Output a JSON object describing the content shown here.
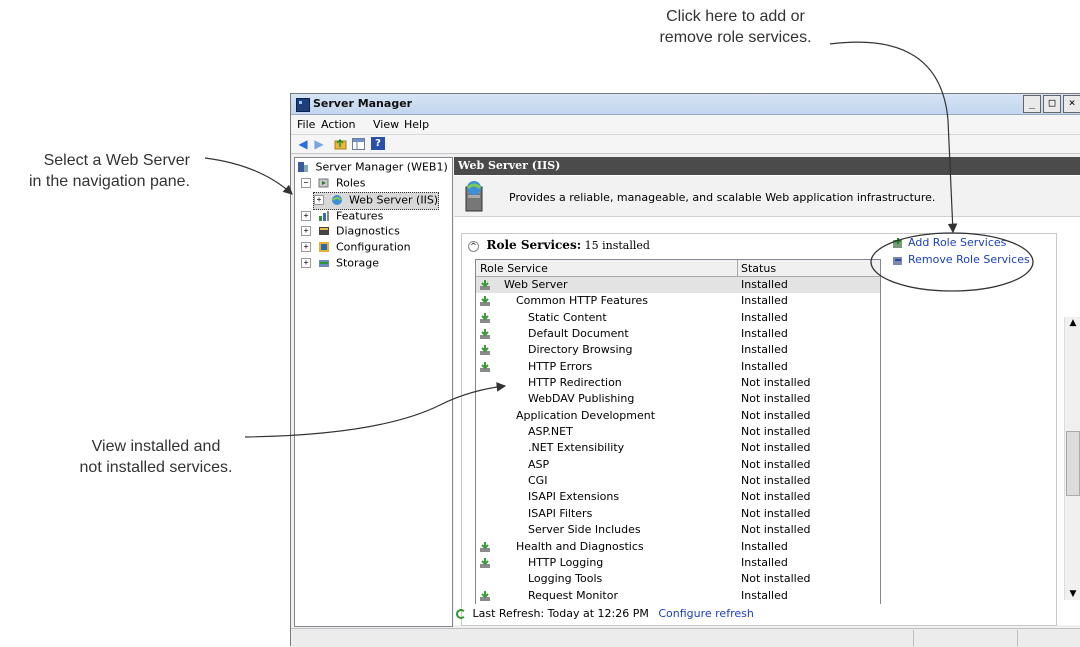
{
  "callouts": {
    "top_right": [
      "Click here to add or",
      "remove role services."
    ],
    "left_top": [
      "Select a Web Server",
      "in the navigation pane."
    ],
    "left_mid": [
      "View installed and",
      "not installed services."
    ]
  },
  "window": {
    "title": "Server Manager",
    "controls": {
      "minimize": "_",
      "maximize": "□",
      "close": "×"
    }
  },
  "menu": [
    "File",
    "Action",
    "View",
    "Help"
  ],
  "nav": {
    "items": [
      {
        "label": "Server Manager (WEB1)",
        "icon": "server-manager-icon"
      },
      {
        "label": "Roles",
        "icon": "roles-icon"
      },
      {
        "label": "Web Server (IIS)",
        "icon": "web-server-icon"
      },
      {
        "label": "Features",
        "icon": "features-icon"
      },
      {
        "label": "Diagnostics",
        "icon": "diagnostics-icon"
      },
      {
        "label": "Configuration",
        "icon": "configuration-icon"
      },
      {
        "label": "Storage",
        "icon": "storage-icon"
      }
    ]
  },
  "content": {
    "header": "Web Server (IIS)",
    "description": "Provides a reliable, manageable, and scalable Web application infrastructure.",
    "role_services": {
      "title": "Role Services:",
      "count": "15 installed",
      "columns": [
        "Role Service",
        "Status"
      ],
      "rows": [
        {
          "name": "Web Server",
          "status": "Installed",
          "indent": 0,
          "installed": true
        },
        {
          "name": "Common HTTP Features",
          "status": "Installed",
          "indent": 1,
          "installed": true
        },
        {
          "name": "Static Content",
          "status": "Installed",
          "indent": 2,
          "installed": true
        },
        {
          "name": "Default Document",
          "status": "Installed",
          "indent": 2,
          "installed": true
        },
        {
          "name": "Directory Browsing",
          "status": "Installed",
          "indent": 2,
          "installed": true
        },
        {
          "name": "HTTP Errors",
          "status": "Installed",
          "indent": 2,
          "installed": true
        },
        {
          "name": "HTTP Redirection",
          "status": "Not installed",
          "indent": 2,
          "installed": false
        },
        {
          "name": "WebDAV Publishing",
          "status": "Not installed",
          "indent": 2,
          "installed": false
        },
        {
          "name": "Application Development",
          "status": "Not installed",
          "indent": 1,
          "installed": false
        },
        {
          "name": "ASP.NET",
          "status": "Not installed",
          "indent": 2,
          "installed": false
        },
        {
          "name": ".NET Extensibility",
          "status": "Not installed",
          "indent": 2,
          "installed": false
        },
        {
          "name": "ASP",
          "status": "Not installed",
          "indent": 2,
          "installed": false
        },
        {
          "name": "CGI",
          "status": "Not installed",
          "indent": 2,
          "installed": false
        },
        {
          "name": "ISAPI Extensions",
          "status": "Not installed",
          "indent": 2,
          "installed": false
        },
        {
          "name": "ISAPI Filters",
          "status": "Not installed",
          "indent": 2,
          "installed": false
        },
        {
          "name": "Server Side Includes",
          "status": "Not installed",
          "indent": 2,
          "installed": false
        },
        {
          "name": "Health and Diagnostics",
          "status": "Installed",
          "indent": 1,
          "installed": true
        },
        {
          "name": "HTTP Logging",
          "status": "Installed",
          "indent": 2,
          "installed": true
        },
        {
          "name": "Logging Tools",
          "status": "Not installed",
          "indent": 2,
          "installed": false
        },
        {
          "name": "Request Monitor",
          "status": "Installed",
          "indent": 2,
          "installed": true
        }
      ]
    },
    "actions": {
      "add": "Add Role Services",
      "remove": "Remove Role Services"
    },
    "refresh": {
      "text": "Last Refresh: Today at 12:26 PM",
      "link": "Configure refresh"
    }
  },
  "colors": {
    "header_bg": "#4b4b4b",
    "link": "#1a3fb8",
    "installed_icon": "#3c9a3c"
  }
}
